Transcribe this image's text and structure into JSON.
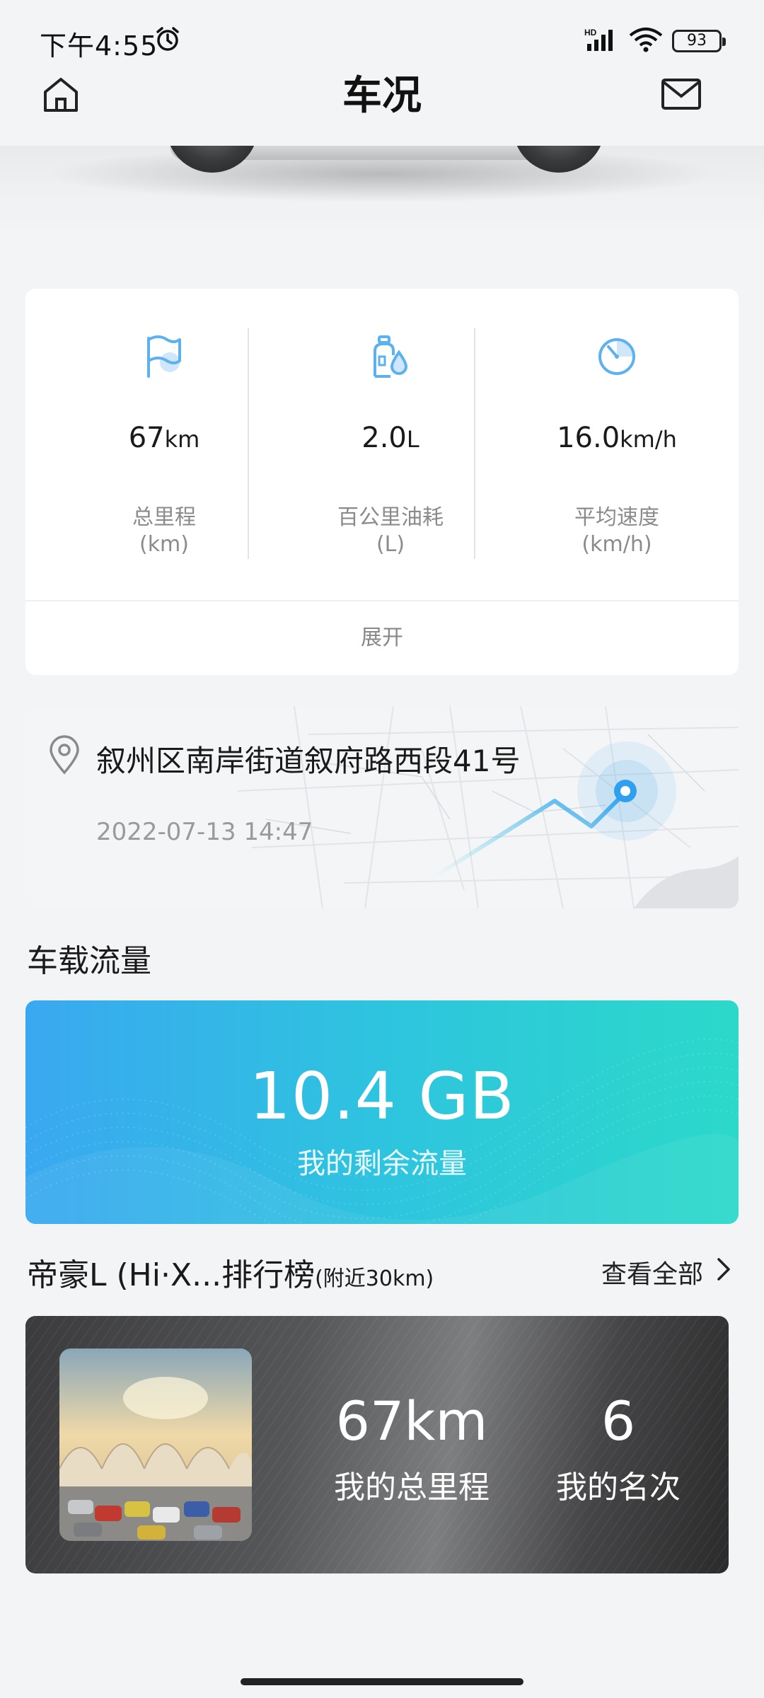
{
  "status_bar": {
    "time": "下午4:55",
    "battery": "93",
    "network": "HD"
  },
  "header": {
    "title": "车况"
  },
  "stats": {
    "items": [
      {
        "value": "67",
        "unit": "km",
        "label": "总里程",
        "sub": "(km)",
        "icon": "flag-icon"
      },
      {
        "value": "2.0",
        "unit": "L",
        "label": "百公里油耗",
        "sub": "(L)",
        "icon": "fuel-icon"
      },
      {
        "value": "16.0",
        "unit": "km/h",
        "label": "平均速度",
        "sub": "(km/h)",
        "icon": "speed-icon"
      }
    ],
    "expand_label": "展开"
  },
  "location": {
    "address": "叙州区南岸街道叙府路西段41号",
    "timestamp": "2022-07-13 14:47"
  },
  "data_traffic": {
    "section_title": "车载流量",
    "amount": "10.4 GB",
    "label": "我的剩余流量"
  },
  "ranking": {
    "title": "帝豪L (Hi·X...排行榜",
    "title_sub": "(附近30km)",
    "view_all": "查看全部",
    "mileage": "67km",
    "mileage_label": "我的总里程",
    "position": "6",
    "position_label": "我的名次"
  },
  "colors": {
    "accent_blue": "#3aa8f0",
    "accent_teal": "#2bd9c9",
    "icon_blue": "#5bb2ee"
  }
}
